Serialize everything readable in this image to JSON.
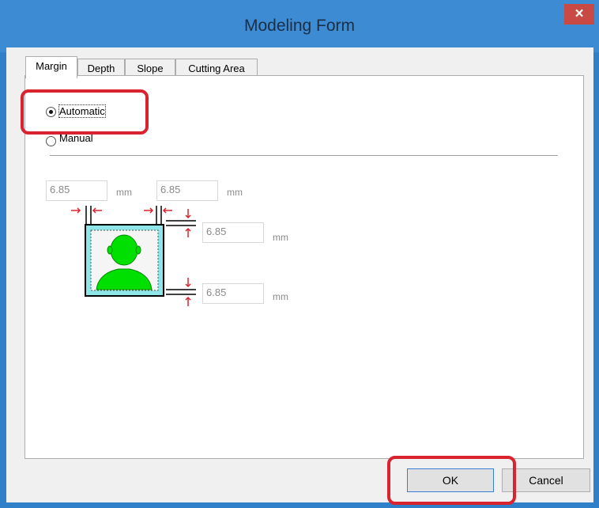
{
  "window": {
    "title": "Modeling Form",
    "close_symbol": "×"
  },
  "tabs": [
    {
      "label": "Margin",
      "active": true
    },
    {
      "label": "Depth",
      "active": false
    },
    {
      "label": "Slope",
      "active": false
    },
    {
      "label": "Cutting Area",
      "active": false
    }
  ],
  "margin": {
    "mode_options": [
      {
        "label": "Automatic",
        "selected": true
      },
      {
        "label": "Manual",
        "selected": false
      }
    ],
    "left_value": "6.85",
    "right_value": "6.85",
    "top_value": "6.85",
    "bottom_value": "6.85",
    "unit": "mm"
  },
  "buttons": {
    "ok": "OK",
    "cancel": "Cancel"
  },
  "colors": {
    "highlight": "#d9232e",
    "title_bar": "#3d8bd3",
    "figure": "#00e000",
    "frame": "#8fe6e8",
    "arrows": "#d9232e"
  }
}
